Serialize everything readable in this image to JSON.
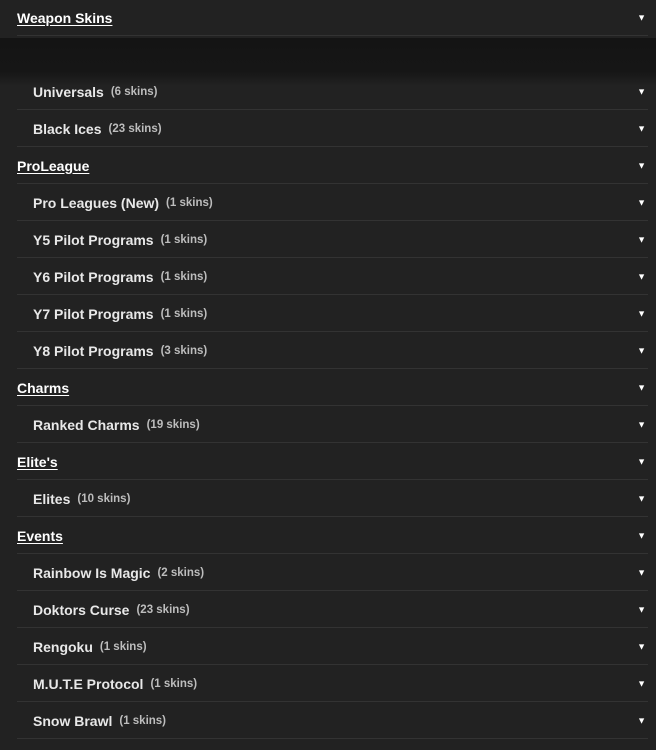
{
  "caret_glyph": "▼",
  "rows": [
    {
      "kind": "section",
      "label": "Weapon Skins",
      "count": ""
    },
    {
      "kind": "item",
      "label": "Universals",
      "count": "(6 skins)"
    },
    {
      "kind": "item",
      "label": "Black Ices",
      "count": "(23 skins)"
    },
    {
      "kind": "section",
      "label": "ProLeague",
      "count": ""
    },
    {
      "kind": "item",
      "label": "Pro Leagues (New)",
      "count": "(1 skins)"
    },
    {
      "kind": "item",
      "label": "Y5 Pilot Programs",
      "count": "(1 skins)"
    },
    {
      "kind": "item",
      "label": "Y6 Pilot Programs",
      "count": "(1 skins)"
    },
    {
      "kind": "item",
      "label": "Y7 Pilot Programs",
      "count": "(1 skins)"
    },
    {
      "kind": "item",
      "label": "Y8 Pilot Programs",
      "count": "(3 skins)"
    },
    {
      "kind": "section",
      "label": "Charms",
      "count": ""
    },
    {
      "kind": "item",
      "label": "Ranked Charms",
      "count": "(19 skins)"
    },
    {
      "kind": "section",
      "label": "Elite's",
      "count": ""
    },
    {
      "kind": "item",
      "label": "Elites",
      "count": "(10 skins)"
    },
    {
      "kind": "section",
      "label": "Events",
      "count": ""
    },
    {
      "kind": "item",
      "label": "Rainbow Is Magic",
      "count": "(2 skins)"
    },
    {
      "kind": "item",
      "label": "Doktors Curse",
      "count": "(23 skins)"
    },
    {
      "kind": "item",
      "label": "Rengoku",
      "count": "(1 skins)"
    },
    {
      "kind": "item",
      "label": "M.U.T.E Protocol",
      "count": "(1 skins)"
    },
    {
      "kind": "item",
      "label": "Snow Brawl",
      "count": "(1 skins)"
    }
  ]
}
